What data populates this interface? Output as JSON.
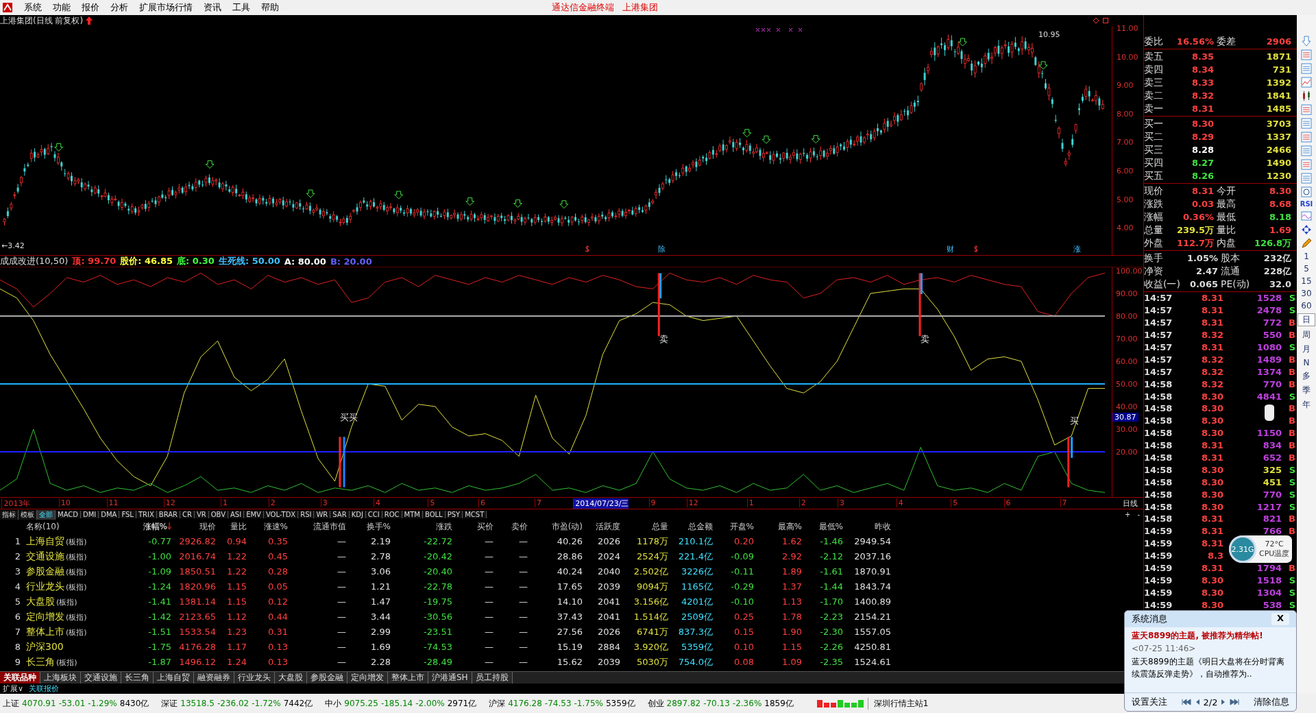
{
  "menu": [
    "系统",
    "功能",
    "报价",
    "分析",
    "扩展市场行情",
    "资讯",
    "工具",
    "帮助"
  ],
  "app_title": "通达信金融终端",
  "stock_title": "上港集团",
  "chart_title": "上港集团(日线 前复权)",
  "price_axis": [
    "11.00",
    "10.00",
    "9.00",
    "8.00",
    "7.00",
    "6.00",
    "5.00",
    "4.00"
  ],
  "high_label": "10.95",
  "low_label": "←3.42",
  "events": [
    "除",
    "财",
    "涨"
  ],
  "indicator": {
    "name": "成成改进(10,50)",
    "params": [
      {
        "label": "顶: 99.70",
        "color": "#ff3030"
      },
      {
        "label": "股价: 46.85",
        "color": "#ffff40"
      },
      {
        "label": "底: 0.30",
        "color": "#40ff40"
      },
      {
        "label": "生死线: 50.00",
        "color": "#40c0ff"
      },
      {
        "label": "A: 80.00",
        "color": "#ffffff"
      },
      {
        "label": "B: 20.00",
        "color": "#6060ff"
      }
    ],
    "chart_data": {
      "type": "line",
      "ylim": [
        0,
        101.5
      ],
      "yticks": [
        {
          "value": 100,
          "label": "100.00"
        },
        {
          "value": 90,
          "label": "90.00"
        },
        {
          "value": 80,
          "label": "80.00"
        },
        {
          "value": 70,
          "label": "70.00"
        },
        {
          "value": 60,
          "label": "60.00"
        },
        {
          "value": 50,
          "label": "50.00"
        },
        {
          "value": 40,
          "label": "40.00"
        },
        {
          "value": 30,
          "label": "30.00"
        },
        {
          "value": 20,
          "label": "20.00"
        }
      ],
      "series": [
        {
          "color": "#e02020",
          "values": [
            96,
            92,
            84,
            90,
            97,
            95,
            98,
            94,
            96,
            93,
            97,
            95,
            99,
            94,
            96,
            92,
            98,
            95,
            97,
            94,
            96,
            86,
            88,
            95,
            97,
            93,
            98,
            96,
            94,
            97,
            95,
            98,
            96,
            94,
            97,
            95,
            98,
            96,
            93,
            92,
            99,
            96,
            95,
            97,
            94,
            98,
            96,
            95,
            88,
            90,
            96,
            97,
            95,
            98,
            94,
            96,
            97,
            95,
            98,
            96,
            94,
            93,
            82,
            80,
            90,
            97,
            99
          ]
        },
        {
          "color": "#e0e040",
          "values": [
            92,
            88,
            78,
            63,
            51,
            39,
            26,
            16,
            9,
            5,
            18,
            46,
            62,
            69,
            53,
            47,
            52,
            61,
            38,
            17,
            7,
            31,
            50,
            49,
            34,
            41,
            40,
            31,
            27,
            28,
            25,
            18,
            45,
            26,
            19,
            36,
            63,
            78,
            81,
            86,
            85,
            80,
            78,
            79,
            80,
            69,
            58,
            48,
            46,
            51,
            60,
            75,
            90,
            91,
            92,
            92,
            83,
            71,
            56,
            61,
            62,
            60,
            43,
            23,
            27,
            48,
            48
          ]
        },
        {
          "color": "#30c030",
          "values": [
            3,
            8,
            30,
            6,
            3,
            5,
            2,
            4,
            3,
            6,
            2,
            5,
            9,
            3,
            4,
            2,
            5,
            3,
            6,
            2,
            4,
            3,
            5,
            2,
            6,
            3,
            4,
            2,
            5,
            3,
            4,
            6,
            10,
            3,
            4,
            2,
            5,
            3,
            6,
            20,
            8,
            4,
            3,
            5,
            2,
            6,
            3,
            4,
            10,
            3,
            5,
            2,
            4,
            6,
            3,
            22,
            5,
            3,
            4,
            2,
            6,
            3,
            18,
            20,
            6,
            3,
            2
          ]
        },
        {
          "color": "#aaaaaa",
          "values": [
            80,
            80,
            80,
            80,
            80,
            80,
            80,
            80,
            80,
            80,
            80,
            80,
            80,
            80,
            80,
            80,
            80,
            80,
            80,
            80,
            80,
            80,
            80,
            80,
            80,
            80,
            80,
            80,
            80,
            80,
            80,
            80,
            80,
            80,
            80,
            80,
            80,
            80,
            80,
            80,
            80,
            80,
            80,
            80,
            80,
            80,
            80,
            80,
            80,
            80,
            80,
            80,
            80,
            80,
            80,
            80,
            80,
            80,
            80,
            80,
            80,
            80,
            80,
            80,
            80,
            80,
            80
          ]
        },
        {
          "color": "#20b0ff",
          "values": [
            50,
            50,
            50,
            50,
            50,
            50,
            50,
            50,
            50,
            50,
            50,
            50,
            50,
            50,
            50,
            50,
            50,
            50,
            50,
            50,
            50,
            50,
            50,
            50,
            50,
            50,
            50,
            50,
            50,
            50,
            50,
            50,
            50,
            50,
            50,
            50,
            50,
            50,
            50,
            50,
            50,
            50,
            50,
            50,
            50,
            50,
            50,
            50,
            50,
            50,
            50,
            50,
            50,
            50,
            50,
            50,
            50,
            50,
            50,
            50,
            50,
            50,
            50,
            50,
            50,
            50,
            50
          ]
        },
        {
          "color": "#2020ff",
          "values": [
            20,
            20,
            20,
            20,
            20,
            20,
            20,
            20,
            20,
            20,
            20,
            20,
            20,
            20,
            20,
            20,
            20,
            20,
            20,
            20,
            20,
            20,
            20,
            20,
            20,
            20,
            20,
            20,
            20,
            20,
            20,
            20,
            20,
            20,
            20,
            20,
            20,
            20,
            20,
            20,
            20,
            20,
            20,
            20,
            20,
            20,
            20,
            20,
            20,
            20,
            20,
            20,
            20,
            20,
            20,
            20,
            20,
            20,
            20,
            20,
            20,
            20,
            20,
            20,
            20,
            20,
            20
          ]
        }
      ]
    }
  },
  "indicator_current": "30.87",
  "signals": [
    "买买",
    "卖",
    "卖",
    "买"
  ],
  "date_axis": [
    "2013年",
    "10",
    "11",
    "12",
    "1",
    "2",
    "3",
    "4",
    "5",
    "6",
    "7",
    "2014/07/23/三",
    "9",
    "12",
    "1",
    "2",
    "3",
    "4",
    "5",
    "6",
    "7"
  ],
  "period_label": "日线",
  "zoom_buttons": [
    "+",
    "-"
  ],
  "indicator_tabs": [
    {
      "label": "指标",
      "selected": false
    },
    {
      "label": "模板",
      "selected": false
    },
    {
      "label": "全部",
      "selected": true
    },
    {
      "label": "MACD",
      "selected": false
    },
    {
      "label": "DMI",
      "selected": false
    },
    {
      "label": "DMA",
      "selected": false
    },
    {
      "label": "FSL",
      "selected": false
    },
    {
      "label": "TRIX",
      "selected": false
    },
    {
      "label": "BRAR",
      "selected": false
    },
    {
      "label": "CR",
      "selected": false
    },
    {
      "label": "VR",
      "selected": false
    },
    {
      "label": "OBV",
      "selected": false
    },
    {
      "label": "ASI",
      "selected": false
    },
    {
      "label": "EMV",
      "selected": false
    },
    {
      "label": "VOL-TDX",
      "selected": false
    },
    {
      "label": "RSI",
      "selected": false
    },
    {
      "label": "WR",
      "selected": false
    },
    {
      "label": "SAR",
      "selected": false
    },
    {
      "label": "KDJ",
      "selected": false
    },
    {
      "label": "CCI",
      "selected": false
    },
    {
      "label": "ROC",
      "selected": false
    },
    {
      "label": "MTM",
      "selected": false
    },
    {
      "label": "BOLL",
      "selected": false
    },
    {
      "label": "PSY",
      "selected": false
    },
    {
      "label": "MCST",
      "selected": false
    }
  ],
  "table": {
    "name_column": "名称(10)",
    "columns": [
      {
        "label": "涨幅%",
        "sorted": true
      },
      {
        "label": "现价",
        "sorted": false
      },
      {
        "label": "量比",
        "sorted": false
      },
      {
        "label": "涨速%",
        "sorted": false
      },
      {
        "label": "流通市值",
        "sorted": false
      },
      {
        "label": "换手%",
        "sorted": false
      },
      {
        "label": "涨跌",
        "sorted": false
      },
      {
        "label": "买价",
        "sorted": false
      },
      {
        "label": "卖价",
        "sorted": false
      },
      {
        "label": "市盈(动)",
        "sorted": false
      },
      {
        "label": "活跃度",
        "sorted": false
      },
      {
        "label": "总量",
        "sorted": false
      },
      {
        "label": "总金额",
        "sorted": false
      },
      {
        "label": "开盘%",
        "sorted": false
      },
      {
        "label": "最高%",
        "sorted": false
      },
      {
        "label": "最低%",
        "sorted": false
      },
      {
        "label": "昨收",
        "sorted": false
      }
    ],
    "rows": [
      {
        "no": "1",
        "name": "上海自贸",
        "suffix": "(板指)",
        "cells": [
          "-0.77",
          "2926.82",
          "0.94",
          "0.35",
          "—",
          "2.19",
          "-22.72",
          "—",
          "—",
          "40.26",
          "2026",
          "1178万",
          "210.1亿",
          "0.20",
          "1.62",
          "-1.46",
          "2949.54"
        ]
      },
      {
        "no": "2",
        "name": "交通设施",
        "suffix": "(板指)",
        "cells": [
          "-1.00",
          "2016.74",
          "1.22",
          "0.45",
          "—",
          "2.78",
          "-20.42",
          "—",
          "—",
          "28.86",
          "2024",
          "2524万",
          "221.4亿",
          "-0.09",
          "2.92",
          "-2.12",
          "2037.16"
        ]
      },
      {
        "no": "3",
        "name": "参股金融",
        "suffix": "(板指)",
        "cells": [
          "-1.09",
          "1850.51",
          "1.22",
          "0.28",
          "—",
          "3.06",
          "-20.40",
          "—",
          "—",
          "40.24",
          "2040",
          "2.502亿",
          "3226亿",
          "-0.11",
          "1.89",
          "-1.61",
          "1870.91"
        ]
      },
      {
        "no": "4",
        "name": "行业龙头",
        "suffix": "(板指)",
        "cells": [
          "-1.24",
          "1820.96",
          "1.15",
          "0.05",
          "—",
          "1.21",
          "-22.78",
          "—",
          "—",
          "17.65",
          "2039",
          "9094万",
          "1165亿",
          "-0.29",
          "1.37",
          "-1.44",
          "1843.74"
        ]
      },
      {
        "no": "5",
        "name": "大盘股",
        "suffix": "(板指)",
        "cells": [
          "-1.41",
          "1381.14",
          "1.15",
          "0.12",
          "—",
          "1.47",
          "-19.75",
          "—",
          "—",
          "14.10",
          "2041",
          "3.156亿",
          "4201亿",
          "-0.10",
          "1.13",
          "-1.70",
          "1400.89"
        ]
      },
      {
        "no": "6",
        "name": "定向增发",
        "suffix": "(板指)",
        "cells": [
          "-1.42",
          "2123.65",
          "1.12",
          "0.44",
          "—",
          "3.44",
          "-30.56",
          "—",
          "—",
          "37.43",
          "2041",
          "1.514亿",
          "2509亿",
          "0.25",
          "1.78",
          "-2.23",
          "2154.21"
        ]
      },
      {
        "no": "7",
        "name": "整体上市",
        "suffix": "(板指)",
        "cells": [
          "-1.51",
          "1533.54",
          "1.23",
          "0.31",
          "—",
          "2.99",
          "-23.51",
          "—",
          "—",
          "27.56",
          "2026",
          "6741万",
          "837.3亿",
          "0.15",
          "1.90",
          "-2.30",
          "1557.05"
        ]
      },
      {
        "no": "8",
        "name": "沪深300",
        "cells": [
          "-1.75",
          "4176.28",
          "1.17",
          "0.13",
          "—",
          "1.69",
          "-74.53",
          "—",
          "—",
          "15.19",
          "2884",
          "3.920亿",
          "5359亿",
          "0.10",
          "1.15",
          "-2.26",
          "4250.81"
        ]
      },
      {
        "no": "9",
        "name": "长三角",
        "suffix": "(板指)",
        "cells": [
          "-1.87",
          "1496.12",
          "1.24",
          "0.13",
          "—",
          "2.28",
          "-28.49",
          "—",
          "—",
          "15.62",
          "2039",
          "5030万",
          "754.0亿",
          "0.08",
          "1.09",
          "-2.35",
          "1524.61"
        ]
      }
    ]
  },
  "bottom_tabs": [
    {
      "label": "关联品种",
      "selected": true
    },
    {
      "label": "上海板块",
      "selected": false
    },
    {
      "label": "交通设施",
      "selected": false
    },
    {
      "label": "长三角",
      "selected": false
    },
    {
      "label": "上海自贸",
      "selected": false
    },
    {
      "label": "融资融券",
      "selected": false
    },
    {
      "label": "行业龙头",
      "selected": false
    },
    {
      "label": "大盘股",
      "selected": false
    },
    {
      "label": "参股金融",
      "selected": false
    },
    {
      "label": "定向增发",
      "selected": false
    },
    {
      "label": "整体上市",
      "selected": false
    },
    {
      "label": "沪港通SH",
      "selected": false
    },
    {
      "label": "员工持股",
      "selected": false
    }
  ],
  "expand_button": "扩展∨",
  "related_quote": "关联报价",
  "status_bar": {
    "indices": [
      {
        "name": "上证",
        "value": "4070.91",
        "change": "-53.01",
        "pct": "-1.29%",
        "amount": "8430亿"
      },
      {
        "name": "深证",
        "value": "13518.5",
        "change": "-236.02",
        "pct": "-1.72%",
        "amount": "7442亿"
      },
      {
        "name": "中小",
        "value": "9075.25",
        "change": "-185.14",
        "pct": "-2.00%",
        "amount": "2971亿"
      },
      {
        "name": "沪深",
        "value": "4176.28",
        "change": "-74.53",
        "pct": "-1.75%",
        "amount": "5359亿"
      },
      {
        "name": "创业",
        "value": "2897.82",
        "change": "-70.13",
        "pct": "-2.36%",
        "amount": "1859亿"
      }
    ],
    "server": "深圳行情主站1"
  },
  "quote_panel": {
    "ratio": [
      {
        "label": "委比",
        "value": "16.56%"
      },
      {
        "label": "委差",
        "value": "2906"
      }
    ],
    "asks": [
      {
        "label": "卖五",
        "price": "8.35",
        "volume": "1871",
        "color": "#ff4040"
      },
      {
        "label": "卖四",
        "price": "8.34",
        "volume": "731",
        "color": "#ff4040"
      },
      {
        "label": "卖三",
        "price": "8.33",
        "volume": "1392",
        "color": "#ff4040"
      },
      {
        "label": "卖二",
        "price": "8.32",
        "volume": "1841",
        "color": "#ff4040"
      },
      {
        "label": "卖一",
        "price": "8.31",
        "volume": "1485",
        "color": "#ff4040"
      }
    ],
    "bids": [
      {
        "label": "买一",
        "price": "8.30",
        "volume": "3703",
        "color": "#ff4040"
      },
      {
        "label": "买二",
        "price": "8.29",
        "volume": "1337",
        "color": "#ff4040"
      },
      {
        "label": "买三",
        "price": "8.28",
        "volume": "2466",
        "color": "#ffffff"
      },
      {
        "label": "买四",
        "price": "8.27",
        "volume": "1490",
        "color": "#40e040"
      },
      {
        "label": "买五",
        "price": "8.26",
        "volume": "1230",
        "color": "#40e040"
      }
    ],
    "stats": [
      {
        "label": "现价",
        "value": "8.31",
        "color": "#ff4040"
      },
      {
        "label": "今开",
        "value": "8.30",
        "color": "#ff4040"
      },
      {
        "label": "涨跌",
        "value": "0.03",
        "color": "#ff4040"
      },
      {
        "label": "最高",
        "value": "8.68",
        "color": "#ff4040"
      },
      {
        "label": "涨幅",
        "value": "0.36%",
        "color": "#ff4040"
      },
      {
        "label": "最低",
        "value": "8.18",
        "color": "#40e040"
      },
      {
        "label": "总量",
        "value": "239.5万",
        "color": "#e0e040"
      },
      {
        "label": "量比",
        "value": "1.69",
        "color": "#ff4040"
      },
      {
        "label": "外盘",
        "value": "112.7万",
        "color": "#ff4040"
      },
      {
        "label": "内盘",
        "value": "126.8万",
        "color": "#40e040"
      }
    ],
    "info": [
      {
        "label": "换手",
        "value": "1.05%"
      },
      {
        "label": "股本",
        "value": "232亿"
      },
      {
        "label": "净资",
        "value": "2.47"
      },
      {
        "label": "流通",
        "value": "228亿"
      },
      {
        "label": "收益(一)",
        "value": "0.065"
      },
      {
        "label": "PE(动)",
        "value": "32.0"
      }
    ],
    "ticks": [
      {
        "time": "14:57",
        "price": "8.31",
        "volume": "1528",
        "side": "S",
        "color": "#c040e0"
      },
      {
        "time": "14:57",
        "price": "8.31",
        "volume": "2478",
        "side": "S",
        "color": "#c040e0"
      },
      {
        "time": "14:57",
        "price": "8.31",
        "volume": "772",
        "side": "B",
        "color": "#c040e0"
      },
      {
        "time": "14:57",
        "price": "8.32",
        "volume": "550",
        "side": "B",
        "color": "#c040e0"
      },
      {
        "time": "14:57",
        "price": "8.31",
        "volume": "1080",
        "side": "S",
        "color": "#c040e0"
      },
      {
        "time": "14:57",
        "price": "8.32",
        "volume": "1489",
        "side": "B",
        "color": "#c040e0"
      },
      {
        "time": "14:57",
        "price": "8.32",
        "volume": "1374",
        "side": "B",
        "color": "#c040e0"
      },
      {
        "time": "14:58",
        "price": "8.32",
        "volume": "770",
        "side": "B",
        "color": "#c040e0"
      },
      {
        "time": "14:58",
        "price": "8.30",
        "volume": "4841",
        "side": "S",
        "color": "#c040e0"
      },
      {
        "time": "14:58",
        "price": "8.30",
        "side": "B"
      },
      {
        "time": "14:58",
        "price": "8.30",
        "side": "B"
      },
      {
        "time": "14:58",
        "price": "8.30",
        "volume": "1150",
        "side": "B",
        "color": "#c040e0"
      },
      {
        "time": "14:58",
        "price": "8.31",
        "volume": "834",
        "side": "B",
        "color": "#c040e0"
      },
      {
        "time": "14:58",
        "price": "8.31",
        "volume": "652",
        "side": "B",
        "color": "#c040e0"
      },
      {
        "time": "14:58",
        "price": "8.30",
        "volume": "325",
        "side": "S",
        "color": "#e0e040"
      },
      {
        "time": "14:58",
        "price": "8.30",
        "volume": "451",
        "side": "S",
        "color": "#e0e040"
      },
      {
        "time": "14:58",
        "price": "8.30",
        "volume": "770",
        "side": "S",
        "color": "#c040e0"
      },
      {
        "time": "14:58",
        "price": "8.30",
        "volume": "1217",
        "side": "S",
        "color": "#c040e0"
      },
      {
        "time": "14:58",
        "price": "8.31",
        "volume": "821",
        "side": "B",
        "color": "#c040e0"
      },
      {
        "time": "14:59",
        "price": "8.31",
        "volume": "766",
        "side": "B",
        "color": "#c040e0"
      },
      {
        "time": "14:59",
        "price": "8.31"
      },
      {
        "time": "14:59",
        "price": "8.3"
      },
      {
        "time": "14:59",
        "price": "8.31",
        "volume": "1794",
        "side": "B",
        "color": "#c040e0"
      },
      {
        "time": "14:59",
        "price": "8.30",
        "volume": "1518",
        "side": "S",
        "color": "#c040e0"
      },
      {
        "time": "14:59",
        "price": "8.30",
        "volume": "1304",
        "side": "S",
        "color": "#c040e0"
      },
      {
        "time": "14:59",
        "price": "8.30",
        "volume": "538",
        "side": "S",
        "color": "#c040e0"
      }
    ]
  },
  "side_toolbar": {
    "rsi": "RSI",
    "periods": [
      {
        "label": "1",
        "selected": false
      },
      {
        "label": "5",
        "selected": false
      },
      {
        "label": "15",
        "selected": false
      },
      {
        "label": "30",
        "selected": false
      },
      {
        "label": "60",
        "selected": false
      },
      {
        "label": "日",
        "selected": true
      },
      {
        "label": "周",
        "selected": false
      },
      {
        "label": "月",
        "selected": false
      },
      {
        "label": "N",
        "selected": false
      },
      {
        "label": "多",
        "selected": false
      },
      {
        "label": "季",
        "selected": false
      },
      {
        "label": "年",
        "selected": false
      }
    ]
  },
  "cpu_widget": {
    "memory": "2.31G",
    "temperature": "72°C",
    "label": "CPU温度"
  },
  "message_popup": {
    "title": "系统消息",
    "close": "X",
    "headline": "蓝天8899的主题, 被推荐为精华帖!",
    "time": "<07-25 11:46>",
    "body": "蓝天8899的主题《明日大盘将在分时背离续震荡反弹走势》，自动推荐为..",
    "settings": "设置关注",
    "page": "2/2",
    "clear": "清除信息"
  }
}
